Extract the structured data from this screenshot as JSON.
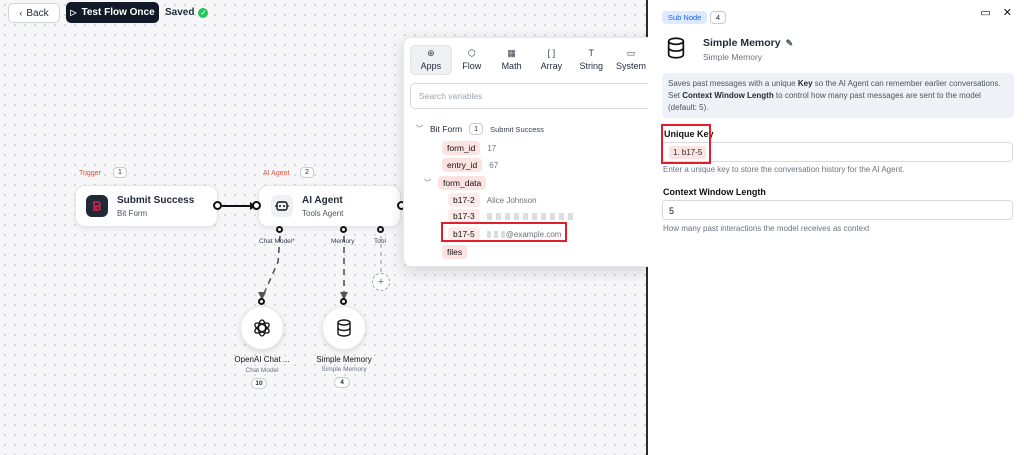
{
  "toolbar": {
    "back_label": "Back",
    "test_label": "Test Flow Once",
    "saved_label": "Saved"
  },
  "canvas": {
    "trigger_node": {
      "tag": "Trigger",
      "number": "1",
      "title": "Submit Success",
      "subtitle": "Bit Form",
      "icon_color": "#e11d48"
    },
    "agent_node": {
      "tag": "AI Agent",
      "number": "2",
      "title": "AI Agent",
      "subtitle": "Tools Agent"
    },
    "connections": {
      "chat_model": "Chat Model*",
      "memory": "Memory",
      "tool": "Tool"
    },
    "openai_node": {
      "title": "OpenAI Chat ...",
      "subtitle": "Chat Model",
      "count": "10"
    },
    "memory_node": {
      "title": "Simple Memory",
      "subtitle": "Simple Memory",
      "count": "4"
    },
    "add_tool_symbol": "+"
  },
  "variables": {
    "tabs": [
      {
        "label": "Apps",
        "icon": "globe-icon",
        "glyph": "⊕"
      },
      {
        "label": "Flow",
        "icon": "cube-icon",
        "glyph": "⬡"
      },
      {
        "label": "Math",
        "icon": "calculator-icon",
        "glyph": "▦"
      },
      {
        "label": "Array",
        "icon": "brackets-icon",
        "glyph": "[ ]"
      },
      {
        "label": "String",
        "icon": "text-icon",
        "glyph": "T"
      },
      {
        "label": "System",
        "icon": "monitor-icon",
        "glyph": "▭"
      }
    ],
    "search_placeholder": "Search variables",
    "root": {
      "label": "Bit Form",
      "count": "1",
      "event": "Submit Success"
    },
    "items": {
      "form_id": {
        "key": "form_id",
        "value": "17"
      },
      "entry_id": {
        "key": "entry_id",
        "value": "67"
      },
      "form_data": {
        "key": "form_data"
      },
      "b17_2": {
        "key": "b17-2",
        "value": "Alice Johnson"
      },
      "b17_3": {
        "key": "b17-3"
      },
      "b17_5": {
        "key": "b17-5",
        "value": "@example.com"
      },
      "files": {
        "key": "files"
      }
    }
  },
  "panel": {
    "badge": "Sub Node",
    "count": "4",
    "title": "Simple Memory",
    "subtitle": "Simple Memory",
    "info": {
      "p1": "Saves past messages with a unique ",
      "b1": "Key",
      "p2": " so the AI Agent can remember earlier conversations. Set ",
      "b2": "Context Window Length",
      "p3": " to control how many past messages are sent to the model (default: 5)."
    },
    "unique_key_label": "Unique Key",
    "unique_key_value": "1. b17-5",
    "unique_key_hint": "Enter a unique key to store the conversation history for the AI Agent.",
    "context_label": "Context Window Length",
    "context_value": "5",
    "context_hint": "How many past interactions the model receives as context"
  },
  "colors": {
    "accent": "#111827",
    "saved": "#22c55e",
    "highlight": "#e11d2e",
    "pill": "#fde2e2",
    "badge": "#dbeafe"
  }
}
